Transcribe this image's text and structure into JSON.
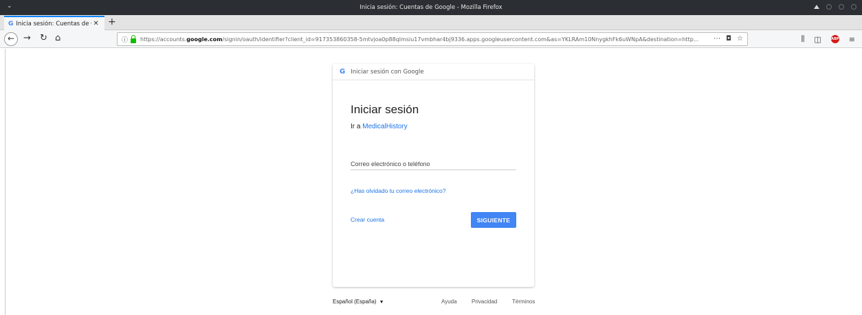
{
  "window": {
    "title": "Inicia sesión: Cuentas de Google - Mozilla Firefox"
  },
  "tab": {
    "label": "Inicia sesión: Cuentas de Go",
    "favicon": "G"
  },
  "navbar": {
    "url_prefix": "https://accounts.",
    "url_domain": "google.com",
    "url_rest": "/signin/oauth/identifier?client_id=917353860358-5mtvjoa0p88qlmsiu17vmbhar4bj9336.apps.googleusercontent.com&as=YKLRAm10NnygkhFk6uWNpA&destination=http..."
  },
  "card": {
    "header": "Iniciar sesión con Google",
    "logo": "G",
    "title": "Iniciar sesión",
    "sub_prefix": "Ir a ",
    "app_name": "MedicalHistory",
    "email_placeholder": "Correo electrónico o teléfono",
    "forgot": "¿Has olvidado tu correo electrónico?",
    "create": "Crear cuenta",
    "next": "SIGUIENTE"
  },
  "footer": {
    "language": "Español (España)",
    "help": "Ayuda",
    "privacy": "Privacidad",
    "terms": "Términos"
  },
  "colors": {
    "accent": "#4285f4",
    "link": "#1a73e8",
    "titlebar": "#2b2e33"
  }
}
